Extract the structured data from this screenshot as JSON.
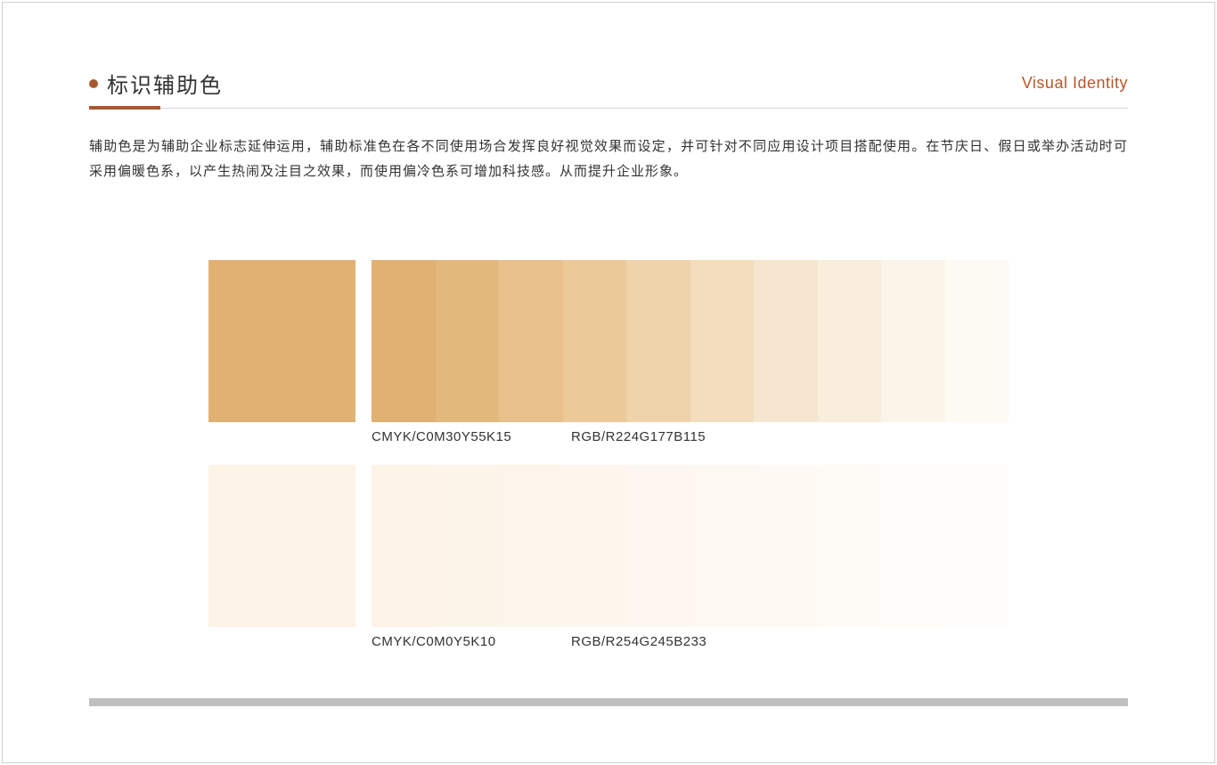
{
  "header": {
    "title": "标识辅助色",
    "subtitle": "Visual Identity"
  },
  "description": "辅助色是为辅助企业标志延伸运用，辅助标准色在各不同使用场合发挥良好视觉效果而设定，并可针对不同应用设计项目搭配使用。在节庆日、假日或举办活动时可采用偏暖色系，以产生热闹及注目之效果，而使用偏冷色系可增加科技感。从而提升企业形象。",
  "palettes": [
    {
      "main_color": "#e0b173",
      "cmyk_label": "CMYK/C0M30Y55K15",
      "rgb_label": "RGB/R224G177B115",
      "gradient": [
        "#e0b173",
        "#e3b87d",
        "#e7c08b",
        "#ebc999",
        "#efd3aa",
        "#f3ddbd",
        "#f6e6cf",
        "#f9eedc",
        "#fbf4e8",
        "#fdfaf3"
      ]
    },
    {
      "main_color": "#fdf3e7",
      "cmyk_label": "CMYK/C0M0Y5K10",
      "rgb_label": "RGB/R254G245B233",
      "gradient": [
        "#fdf3e7",
        "#fdf4e9",
        "#fdf5eb",
        "#fef6ed",
        "#fef7ef",
        "#fef8f1",
        "#fef9f3",
        "#fefaf6",
        "#fffcf9",
        "#fffdfb"
      ]
    }
  ]
}
